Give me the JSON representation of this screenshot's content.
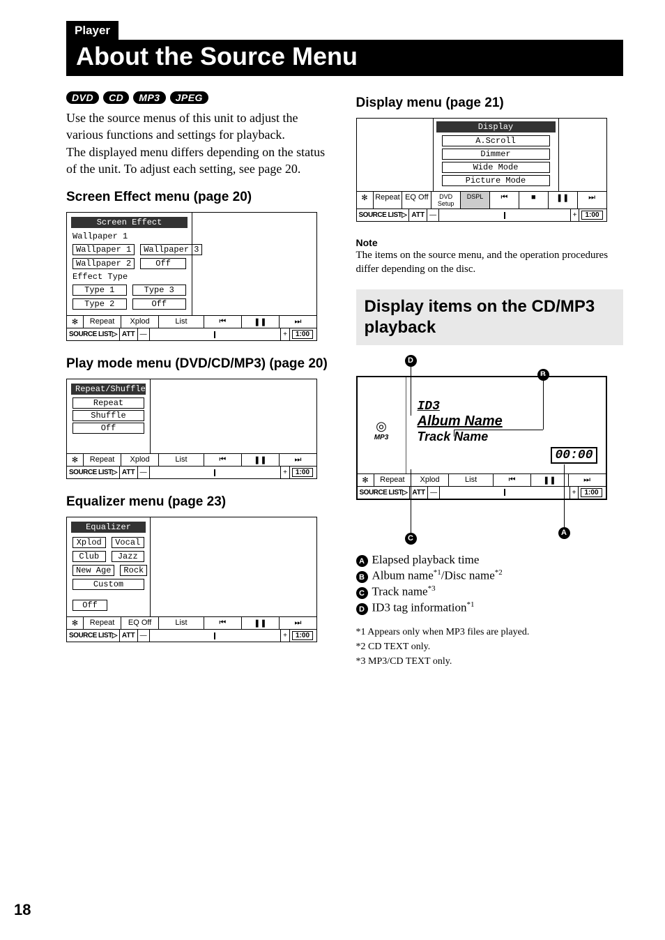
{
  "header": {
    "tab": "Player",
    "title": "About the Source Menu"
  },
  "pills": [
    "DVD",
    "CD",
    "MP3",
    "JPEG"
  ],
  "intro": "Use the source menus of this unit to adjust the various functions and settings for playback.\nThe displayed menu differs depending on the status of the unit. To adjust each setting, see page 20.",
  "sections": {
    "screen_effect": "Screen Effect menu (page 20)",
    "play_mode": "Play mode menu (DVD/CD/MP3) (page 20)",
    "equalizer": "Equalizer menu (page 23)",
    "display": "Display menu (page 21)",
    "cd_mp3": "Display items on the CD/MP3 playback"
  },
  "common_bar": {
    "repeat": "Repeat",
    "xplod": "Xplod",
    "eqoff": "EQ Off",
    "list": "List",
    "dvd": "DVD Setup",
    "dspl": "DSPL",
    "prev": "⏮",
    "stop": "■",
    "pause": "❚❚",
    "next": "⏭",
    "src": "SOURCE LIST▷",
    "att": "ATT",
    "minus": "—",
    "plus": "+",
    "time": "1:00"
  },
  "screen_effect_menu": {
    "title": "Screen Effect",
    "label1": "Wallpaper 1",
    "row1": [
      "Wallpaper 1",
      "Wallpaper 3"
    ],
    "row2": [
      "Wallpaper 2",
      "Off"
    ],
    "label2": "Effect Type",
    "row3": [
      "Type  1",
      "Type  3"
    ],
    "row4": [
      "Type  2",
      "Off"
    ]
  },
  "play_mode_menu": {
    "title": "Repeat/Shuffle",
    "items": [
      "Repeat",
      "Shuffle",
      "Off"
    ]
  },
  "equalizer_menu": {
    "title": "Equalizer",
    "rows": [
      [
        "Xplod",
        "Vocal"
      ],
      [
        "Club",
        "Jazz"
      ],
      [
        "New Age",
        "Rock"
      ]
    ],
    "wide": "Custom",
    "off": "Off"
  },
  "display_menu": {
    "title": "Display",
    "items": [
      "A.Scroll",
      "Dimmer",
      "Wide Mode",
      "Picture Mode"
    ]
  },
  "note": {
    "h": "Note",
    "t": "The items on the source menu, and the operation procedures differ depending on the disc."
  },
  "playback": {
    "id3": "ID3",
    "album": "Album Name",
    "track": "Track Name",
    "time": "00:00",
    "mp3": "MP3",
    "disc": "◎"
  },
  "chart_data": {
    "type": "table",
    "title": "Display items on the CD/MP3 playback callouts",
    "series": [
      {
        "name": "A",
        "values": [
          "Elapsed playback time"
        ]
      },
      {
        "name": "B",
        "values": [
          "Album name*1/Disc name*2"
        ]
      },
      {
        "name": "C",
        "values": [
          "Track name*3"
        ]
      },
      {
        "name": "D",
        "values": [
          "ID3 tag information*1"
        ]
      }
    ]
  },
  "legend": {
    "a": "Elapsed playback time",
    "b_pre": "Album name",
    "b_s1": "*1",
    "b_mid": "/Disc name",
    "b_s2": "*2",
    "c_pre": "Track name",
    "c_s": "*3",
    "d_pre": "ID3 tag information",
    "d_s": "*1"
  },
  "footnotes": [
    "*1  Appears only when MP3 files are played.",
    "*2  CD TEXT only.",
    "*3  MP3/CD TEXT only."
  ],
  "page": "18"
}
